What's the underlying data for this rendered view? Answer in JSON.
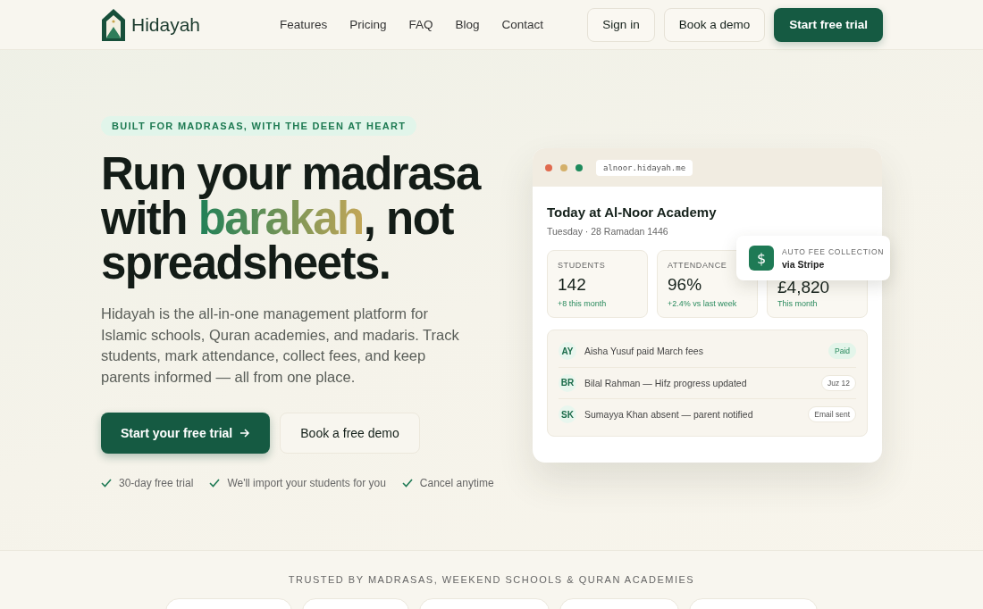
{
  "brand": {
    "name": "Hidayah"
  },
  "nav": [
    "Features",
    "Pricing",
    "FAQ",
    "Blog",
    "Contact"
  ],
  "header_buttons": [
    {
      "label": "Sign in",
      "kind": "outline"
    },
    {
      "label": "Book a demo",
      "kind": "outline"
    },
    {
      "label": "Start free trial",
      "kind": "primary"
    }
  ],
  "hero": {
    "eyebrow": "BUILT FOR MADRASAS, WITH THE DEEN AT HEART",
    "headline_before": "Run your madrasa with",
    "headline_accent": "barakah",
    "headline_after": ", not spreadsheets.",
    "description": "Hidayah is the all-in-one management platform for Islamic schools, Quran academies, and madaris. Track students, mark attendance, collect fees, and keep parents informed — all from one place.",
    "buttons": [
      {
        "label": "Start your free trial",
        "kind": "primary"
      },
      {
        "label": "Book a free demo",
        "kind": "outline"
      }
    ],
    "perks": [
      "30-day free trial",
      "We'll import your students for you",
      "Cancel anytime"
    ]
  },
  "preview": {
    "url": "alnoor.hidayah.me",
    "title": "Today at Al-Noor Academy",
    "subtitle": "Tuesday · 28 Ramadan 1446",
    "stats": [
      {
        "label": "STUDENTS",
        "value": "142",
        "note": "+8 this month"
      },
      {
        "label": "ATTENDANCE",
        "value": "96%",
        "note": "+2.4% vs last week"
      },
      {
        "value": "£4,820",
        "note": "This month"
      }
    ],
    "activity": [
      {
        "initials": "AY",
        "text": "Aisha Yusuf paid March fees",
        "tag": "Paid",
        "kind": "success"
      },
      {
        "initials": "BR",
        "text": "Bilal Rahman — Hifz progress updated",
        "tag": "Juz 12",
        "kind": "neutral"
      },
      {
        "initials": "SK",
        "text": "Sumayya Khan absent — parent notified",
        "tag": "Email sent",
        "kind": "neutral"
      }
    ],
    "popup": {
      "icon": "$",
      "title": "AUTO FEE COLLECTION",
      "subtitle": "via Stripe"
    }
  },
  "trusted": {
    "heading": "TRUSTED BY MADRASAS, WEEKEND SCHOOLS & QURAN ACADEMIES",
    "chips": [
      {
        "kind": "pill"
      },
      {
        "kind": "pill"
      },
      {
        "kind": "pill"
      },
      {
        "kind": "pill"
      },
      {
        "kind": "pill"
      }
    ]
  }
}
